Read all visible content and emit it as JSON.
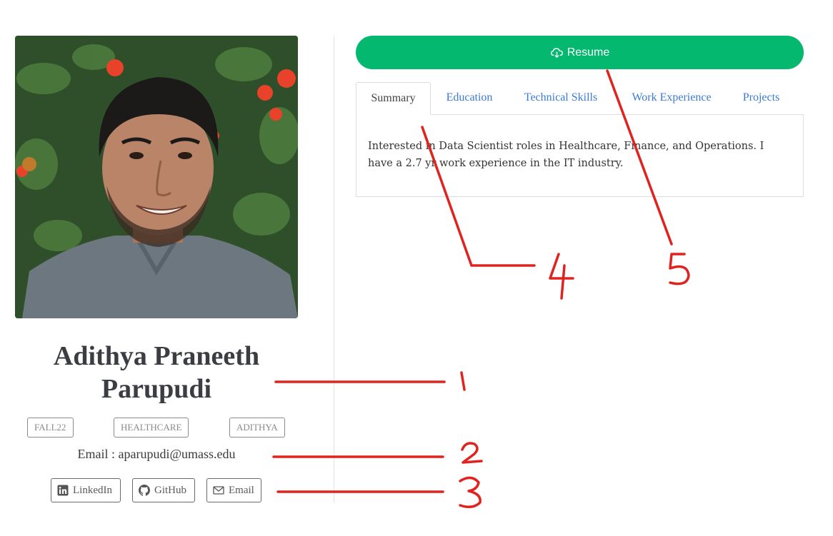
{
  "profile": {
    "photo_icon": "profile-photo",
    "name": "Adithya Praneeth Parupudi",
    "tags": [
      "FALL22",
      "HEALTHCARE",
      "ADITHYA"
    ],
    "email_line": "Email : aparupudi@umass.edu"
  },
  "social": [
    {
      "label": "LinkedIn",
      "icon": "linkedin-icon"
    },
    {
      "label": "GitHub",
      "icon": "github-icon"
    },
    {
      "label": "Email",
      "icon": "mail-icon"
    }
  ],
  "resume": {
    "label": "Resume",
    "icon": "cloud-download-icon",
    "color": "#05b870"
  },
  "tabs": [
    {
      "label": "Summary",
      "active": true
    },
    {
      "label": "Education",
      "active": false
    },
    {
      "label": "Technical Skills",
      "active": false
    },
    {
      "label": "Work Experience",
      "active": false
    },
    {
      "label": "Projects",
      "active": false
    }
  ],
  "summary_text": "Interested in Data Scientist roles in Healthcare, Finance, and Operations. I have a 2.7 yr work experience in the IT industry.",
  "annotations": {
    "color": "#e0231f",
    "numbers": [
      "1",
      "2",
      "3",
      "4",
      "5"
    ]
  }
}
